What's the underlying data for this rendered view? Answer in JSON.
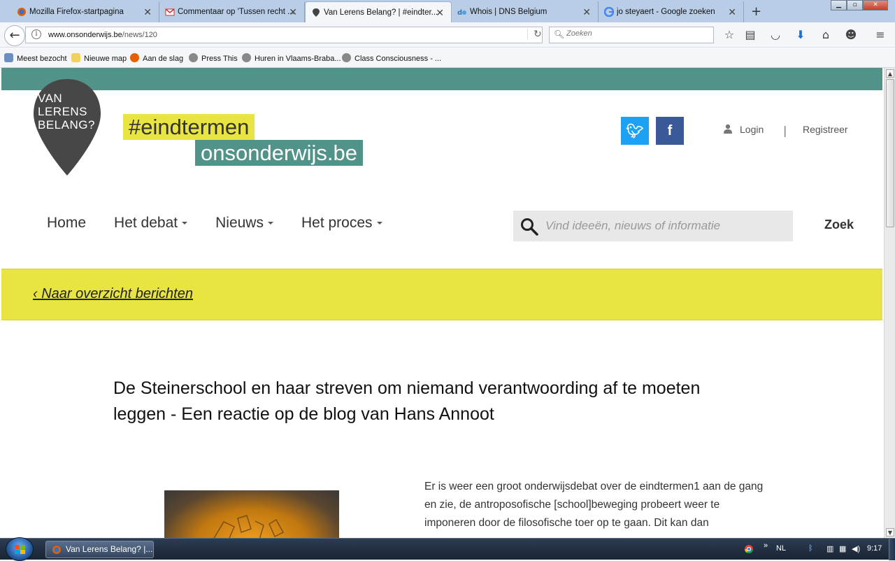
{
  "browser": {
    "tabs": [
      {
        "title": "Mozilla Firefox-startpagina",
        "icon": "firefox-icon"
      },
      {
        "title": "Commentaar op 'Tussen recht ...",
        "icon": "gmail-icon"
      },
      {
        "title": "Van Lerens Belang? | #eindter...",
        "icon": "location-pin-icon",
        "active": true
      },
      {
        "title": "Whois | DNS Belgium",
        "icon": "dns-belgium-icon"
      },
      {
        "title": "jo steyaert - Google zoeken",
        "icon": "google-icon"
      }
    ],
    "url_domain": "www.onsonderwijs.be",
    "url_path": "/news/120",
    "search_placeholder": "Zoeken",
    "bookmarks": [
      "Meest bezocht",
      "Nieuwe map",
      "Aan de slag",
      "Press This",
      "Huren in Vlaams-Braba...",
      "Class Consciousness - ..."
    ]
  },
  "site": {
    "logo_lines": [
      "VAN",
      "LERENS",
      "BELANG?"
    ],
    "tagline_1": "#eindtermen",
    "tagline_2": "onsonderwijs.be",
    "login": "Login",
    "separator": "|",
    "register": "Registreer",
    "nav": [
      "Home",
      "Het debat",
      "Nieuws",
      "Het proces"
    ],
    "search_placeholder": "Vind ideeën, nieuws of informatie",
    "search_button": "Zoek",
    "back_link": "‹ Naar overzicht berichten",
    "colors": {
      "teal": "#519289",
      "yellow": "#e8e542",
      "twitter": "#1da1f2",
      "facebook": "#3b5998"
    }
  },
  "article": {
    "title": "De Steinerschool en haar streven om niemand verantwoording af te moeten leggen - Een reactie op de blog van Hans Annoot",
    "body": "Er is weer een groot onderwijsdebat over de eindtermen1 aan de gang en zie, de antroposofische [school]beweging probeert weer te imponeren door de filosofische toer op te gaan. Dit kan dan"
  },
  "taskbar": {
    "task_title": "Van Lerens Belang? |...",
    "language": "NL",
    "clock": "9:17",
    "expand": "»"
  }
}
